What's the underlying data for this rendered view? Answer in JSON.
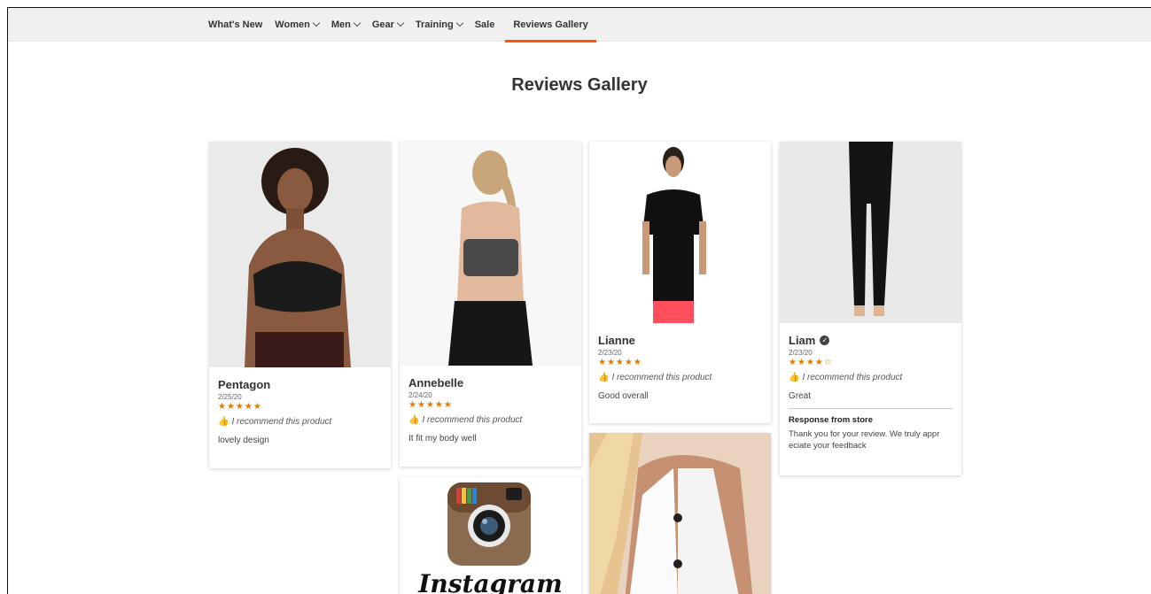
{
  "nav": {
    "items": [
      {
        "label": "What's New",
        "has_dropdown": false
      },
      {
        "label": "Women",
        "has_dropdown": true
      },
      {
        "label": "Men",
        "has_dropdown": true
      },
      {
        "label": "Gear",
        "has_dropdown": true
      },
      {
        "label": "Training",
        "has_dropdown": true
      },
      {
        "label": "Sale",
        "has_dropdown": false
      },
      {
        "label": "Reviews Gallery",
        "has_dropdown": false,
        "active": true
      }
    ]
  },
  "page": {
    "title": "Reviews Gallery"
  },
  "reviews": [
    {
      "name": "Pentagon",
      "date": "2/25/20",
      "stars": "★★★★★",
      "recommend": "I recommend this product",
      "text": "lovely design"
    },
    {
      "name": "Annebelle",
      "date": "2/24/20",
      "stars": "★★★★★",
      "recommend": "I recommend this product",
      "text": "It fit my body well"
    },
    {
      "name": "Lianne",
      "date": "2/23/20",
      "stars": "★★★★★",
      "recommend": "I recommend this product",
      "text": "Good overall"
    },
    {
      "name": "Liam",
      "verified": true,
      "date": "2/23/20",
      "stars": "★★★★☆",
      "recommend": "I recommend this product",
      "text": "Great",
      "response_title": "Response from store",
      "response_text": "Thank you for your review. We truly appr eciate your feedback"
    }
  ],
  "instagram": {
    "label": "Instagram"
  },
  "colors": {
    "accent": "#ff5501",
    "stars": "#e07b00"
  }
}
